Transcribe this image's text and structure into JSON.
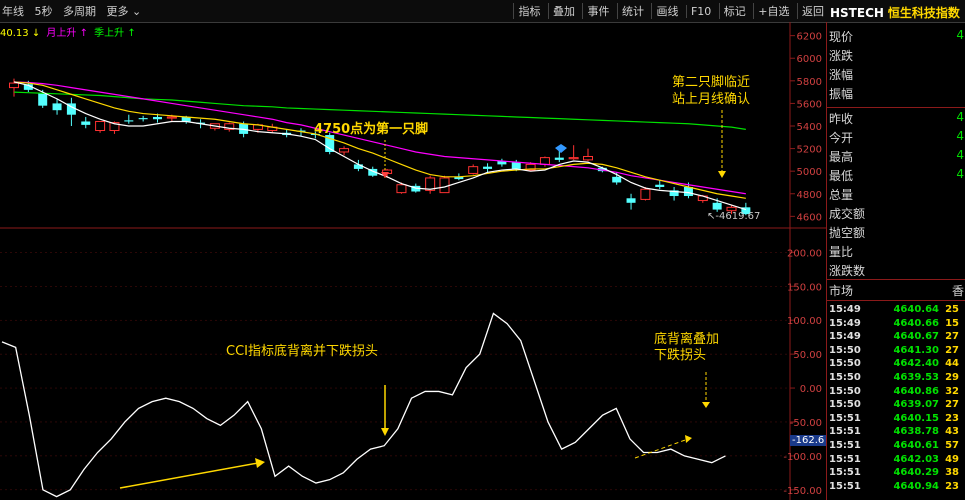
{
  "toolbar": {
    "left_items": [
      "年线",
      "5秒",
      "多周期",
      "更多"
    ],
    "right_items": [
      "指标",
      "叠加",
      "事件",
      "统计",
      "画线",
      "F10",
      "标记",
      "+自选",
      "返回"
    ]
  },
  "header": {
    "code": "HSTECH",
    "name": "恒生科技指数"
  },
  "legend": {
    "value": "40.13",
    "ma_month": "月上升",
    "ma_season": "季上升",
    "arrow_down": "↓",
    "arrow_up": "↑"
  },
  "annotations": {
    "second_foot": [
      "第二只脚临近",
      "站上月线确认"
    ],
    "first_foot": "4750点为第一只脚",
    "cci_note": "CCI指标底背离并下跌拐头",
    "cci_note2": [
      "底背离叠加",
      "下跌拐头"
    ],
    "last_price_label": "4619.67",
    "cci_value_label": "-162.6"
  },
  "axis": {
    "price_ticks": [
      "6200",
      "6000",
      "5800",
      "5600",
      "5400",
      "5200",
      "5000",
      "4800",
      "4600"
    ],
    "cci_ticks": [
      "200.00",
      "150.00",
      "100.00",
      "50.00",
      "0.00",
      "-50.00",
      "-100.00",
      "-150.00"
    ]
  },
  "quote": {
    "rows1": [
      {
        "label": "现价",
        "value": "4"
      },
      {
        "label": "涨跌",
        "value": ""
      },
      {
        "label": "涨幅",
        "value": ""
      },
      {
        "label": "振幅",
        "value": ""
      }
    ],
    "rows2": [
      {
        "label": "昨收",
        "value": "4"
      },
      {
        "label": "今开",
        "value": "4"
      },
      {
        "label": "最高",
        "value": "4"
      },
      {
        "label": "最低",
        "value": "4"
      },
      {
        "label": "总量",
        "value": ""
      },
      {
        "label": "成交额",
        "value": ""
      },
      {
        "label": "抛空额",
        "value": ""
      },
      {
        "label": "量比",
        "value": ""
      },
      {
        "label": "涨跌数",
        "value": ""
      }
    ],
    "market_label": "市场",
    "market_value": "香"
  },
  "ticks": [
    {
      "time": "15:49",
      "price": "4640.64",
      "vol": "25"
    },
    {
      "time": "15:49",
      "price": "4640.66",
      "vol": "15"
    },
    {
      "time": "15:49",
      "price": "4640.67",
      "vol": "27"
    },
    {
      "time": "15:50",
      "price": "4641.30",
      "vol": "27"
    },
    {
      "time": "15:50",
      "price": "4642.40",
      "vol": "44"
    },
    {
      "time": "15:50",
      "price": "4639.53",
      "vol": "29"
    },
    {
      "time": "15:50",
      "price": "4640.86",
      "vol": "32"
    },
    {
      "time": "15:50",
      "price": "4639.07",
      "vol": "27"
    },
    {
      "time": "15:51",
      "price": "4640.15",
      "vol": "23"
    },
    {
      "time": "15:51",
      "price": "4638.78",
      "vol": "43"
    },
    {
      "time": "15:51",
      "price": "4640.61",
      "vol": "57"
    },
    {
      "time": "15:51",
      "price": "4642.03",
      "vol": "49"
    },
    {
      "time": "15:51",
      "price": "4640.29",
      "vol": "38"
    },
    {
      "time": "15:51",
      "price": "4640.94",
      "vol": "23"
    }
  ],
  "chart_data": {
    "type": "candlestick",
    "price_range": [
      4550,
      6250
    ],
    "cci_range": [
      -165,
      230
    ],
    "candles": [
      {
        "o": 5740,
        "h": 5820,
        "l": 5660,
        "c": 5780
      },
      {
        "o": 5770,
        "h": 5800,
        "l": 5700,
        "c": 5720
      },
      {
        "o": 5690,
        "h": 5720,
        "l": 5560,
        "c": 5580
      },
      {
        "o": 5600,
        "h": 5640,
        "l": 5500,
        "c": 5540
      },
      {
        "o": 5600,
        "h": 5650,
        "l": 5400,
        "c": 5500
      },
      {
        "o": 5440,
        "h": 5480,
        "l": 5380,
        "c": 5410
      },
      {
        "o": 5360,
        "h": 5440,
        "l": 5340,
        "c": 5440
      },
      {
        "o": 5360,
        "h": 5440,
        "l": 5330,
        "c": 5430
      },
      {
        "o": 5450,
        "h": 5500,
        "l": 5420,
        "c": 5440
      },
      {
        "o": 5470,
        "h": 5490,
        "l": 5440,
        "c": 5460
      },
      {
        "o": 5480,
        "h": 5510,
        "l": 5430,
        "c": 5460
      },
      {
        "o": 5470,
        "h": 5500,
        "l": 5440,
        "c": 5480
      },
      {
        "o": 5480,
        "h": 5490,
        "l": 5420,
        "c": 5440
      },
      {
        "o": 5430,
        "h": 5460,
        "l": 5380,
        "c": 5420
      },
      {
        "o": 5380,
        "h": 5420,
        "l": 5360,
        "c": 5420
      },
      {
        "o": 5370,
        "h": 5430,
        "l": 5350,
        "c": 5420
      },
      {
        "o": 5420,
        "h": 5440,
        "l": 5300,
        "c": 5330
      },
      {
        "o": 5370,
        "h": 5420,
        "l": 5340,
        "c": 5410
      },
      {
        "o": 5360,
        "h": 5420,
        "l": 5340,
        "c": 5390
      },
      {
        "o": 5340,
        "h": 5370,
        "l": 5300,
        "c": 5320
      },
      {
        "o": 5360,
        "h": 5380,
        "l": 5310,
        "c": 5350
      },
      {
        "o": 5330,
        "h": 5350,
        "l": 5290,
        "c": 5320
      },
      {
        "o": 5320,
        "h": 5340,
        "l": 5150,
        "c": 5170
      },
      {
        "o": 5170,
        "h": 5220,
        "l": 5140,
        "c": 5200
      },
      {
        "o": 5060,
        "h": 5100,
        "l": 5000,
        "c": 5020
      },
      {
        "o": 5020,
        "h": 5040,
        "l": 4950,
        "c": 4960
      },
      {
        "o": 4980,
        "h": 5020,
        "l": 4940,
        "c": 5010
      },
      {
        "o": 4810,
        "h": 4900,
        "l": 4800,
        "c": 4880
      },
      {
        "o": 4870,
        "h": 4890,
        "l": 4810,
        "c": 4820
      },
      {
        "o": 4830,
        "h": 4960,
        "l": 4800,
        "c": 4940
      },
      {
        "o": 4810,
        "h": 4960,
        "l": 4810,
        "c": 4940
      },
      {
        "o": 4950,
        "h": 4980,
        "l": 4920,
        "c": 4930
      },
      {
        "o": 4980,
        "h": 5060,
        "l": 4970,
        "c": 5040
      },
      {
        "o": 5040,
        "h": 5070,
        "l": 4980,
        "c": 5020
      },
      {
        "o": 5090,
        "h": 5110,
        "l": 5040,
        "c": 5060
      },
      {
        "o": 5080,
        "h": 5100,
        "l": 5000,
        "c": 5020
      },
      {
        "o": 5010,
        "h": 5080,
        "l": 5000,
        "c": 5060
      },
      {
        "o": 5060,
        "h": 5130,
        "l": 5040,
        "c": 5120
      },
      {
        "o": 5120,
        "h": 5180,
        "l": 5080,
        "c": 5100
      },
      {
        "o": 5110,
        "h": 5230,
        "l": 5100,
        "c": 5120
      },
      {
        "o": 5100,
        "h": 5200,
        "l": 5090,
        "c": 5130
      },
      {
        "o": 5030,
        "h": 5040,
        "l": 4990,
        "c": 5000
      },
      {
        "o": 4950,
        "h": 4990,
        "l": 4880,
        "c": 4900
      },
      {
        "o": 4760,
        "h": 4800,
        "l": 4660,
        "c": 4720
      },
      {
        "o": 4750,
        "h": 4860,
        "l": 4740,
        "c": 4840
      },
      {
        "o": 4880,
        "h": 4920,
        "l": 4840,
        "c": 4860
      },
      {
        "o": 4830,
        "h": 4860,
        "l": 4740,
        "c": 4780
      },
      {
        "o": 4860,
        "h": 4900,
        "l": 4760,
        "c": 4780
      },
      {
        "o": 4740,
        "h": 4790,
        "l": 4720,
        "c": 4780
      },
      {
        "o": 4720,
        "h": 4760,
        "l": 4640,
        "c": 4660
      },
      {
        "o": 4650,
        "h": 4700,
        "l": 4620,
        "c": 4680
      },
      {
        "o": 4680,
        "h": 4720,
        "l": 4610,
        "c": 4620
      }
    ],
    "ma_white": [
      5790,
      5760,
      5700,
      5640,
      5570,
      5510,
      5460,
      5420,
      5400,
      5400,
      5420,
      5440,
      5440,
      5420,
      5400,
      5380,
      5370,
      5350,
      5340,
      5330,
      5310,
      5280,
      5200,
      5130,
      5060,
      5000,
      4950,
      4890,
      4850,
      4840,
      4860,
      4900,
      4940,
      4990,
      5010,
      5020,
      5000,
      5010,
      5060,
      5090,
      5080,
      5030,
      4970,
      4900,
      4850,
      4830,
      4820,
      4810,
      4780,
      4740,
      4700,
      4660
    ],
    "ma_yellow": [
      5790,
      5780,
      5760,
      5720,
      5680,
      5640,
      5600,
      5560,
      5530,
      5510,
      5500,
      5490,
      5480,
      5470,
      5460,
      5440,
      5420,
      5410,
      5390,
      5370,
      5350,
      5330,
      5290,
      5250,
      5200,
      5160,
      5110,
      5060,
      5010,
      4970,
      4950,
      4950,
      4960,
      4980,
      5000,
      5010,
      5020,
      5020,
      5040,
      5060,
      5070,
      5060,
      5030,
      4990,
      4950,
      4920,
      4890,
      4860,
      4830,
      4800,
      4780,
      4760
    ],
    "ma_magenta": [
      5790,
      5785,
      5775,
      5760,
      5740,
      5720,
      5700,
      5680,
      5660,
      5640,
      5620,
      5600,
      5580,
      5560,
      5540,
      5520,
      5500,
      5480,
      5460,
      5430,
      5410,
      5380,
      5350,
      5320,
      5290,
      5260,
      5230,
      5200,
      5170,
      5150,
      5130,
      5120,
      5110,
      5100,
      5090,
      5080,
      5070,
      5060,
      5050,
      5040,
      5030,
      5010,
      4990,
      4960,
      4940,
      4920,
      4900,
      4880,
      4860,
      4840,
      4820,
      4800
    ],
    "ma_green": [
      5700,
      5695,
      5690,
      5685,
      5680,
      5675,
      5670,
      5660,
      5650,
      5640,
      5635,
      5630,
      5620,
      5610,
      5600,
      5590,
      5580,
      5575,
      5570,
      5560,
      5555,
      5550,
      5545,
      5540,
      5535,
      5530,
      5525,
      5520,
      5515,
      5510,
      5505,
      5500,
      5495,
      5490,
      5485,
      5480,
      5475,
      5470,
      5465,
      5460,
      5455,
      5450,
      5445,
      5440,
      5435,
      5430,
      5425,
      5420,
      5410,
      5400,
      5390,
      5370
    ],
    "cci": [
      68,
      60,
      -40,
      -150,
      -160,
      -150,
      -120,
      -95,
      -75,
      -50,
      -30,
      -20,
      -15,
      -20,
      -30,
      -45,
      -55,
      -40,
      -20,
      -60,
      -130,
      -115,
      -130,
      -140,
      -135,
      -125,
      -105,
      -90,
      -85,
      -60,
      -15,
      -5,
      -5,
      -10,
      30,
      50,
      110,
      95,
      70,
      10,
      -50,
      -90,
      -80,
      -60,
      -40,
      -30,
      -75,
      -95,
      -95,
      -90,
      -100,
      -105,
      -110,
      -100
    ]
  }
}
